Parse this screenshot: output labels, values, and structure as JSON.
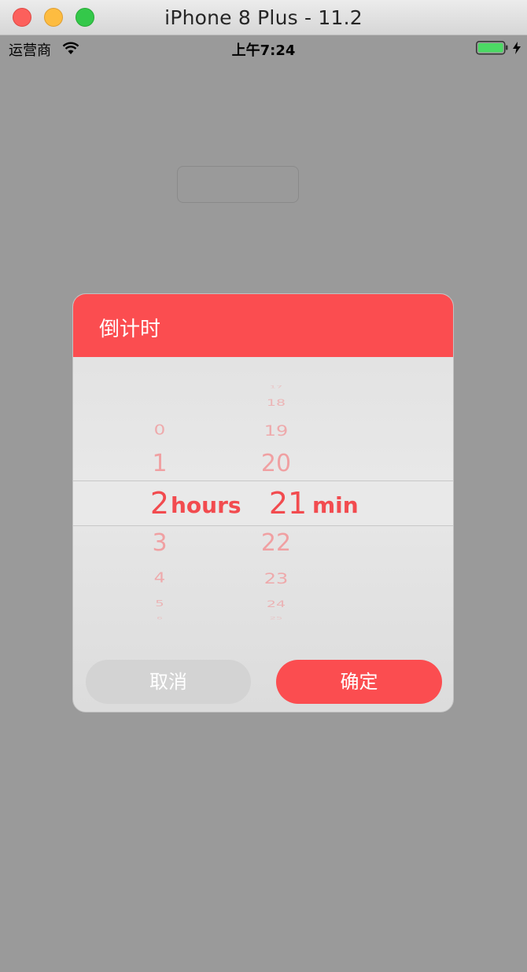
{
  "window": {
    "title": "iPhone 8 Plus - 11.2"
  },
  "status_bar": {
    "carrier": "运营商",
    "time": "上午7:24",
    "battery_color": "#4cd964"
  },
  "dialog": {
    "title": "倒计时",
    "hours": {
      "values": [
        "0",
        "1",
        "2",
        "3",
        "4",
        "5",
        "6"
      ],
      "selected": "2",
      "unit": "hours"
    },
    "minutes": {
      "values": [
        "17",
        "18",
        "19",
        "20",
        "21",
        "22",
        "23",
        "24",
        "25"
      ],
      "selected": "21",
      "unit": "min"
    },
    "cancel_label": "取消",
    "confirm_label": "确定",
    "accent_color": "#fb4d50"
  }
}
